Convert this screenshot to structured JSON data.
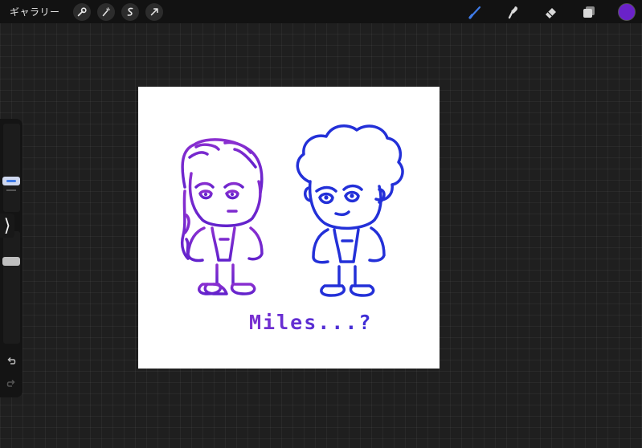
{
  "topbar": {
    "gallery_label": "ギャラリー",
    "left_tools": [
      {
        "icon": "wrench-icon"
      },
      {
        "icon": "magic-wand-icon"
      },
      {
        "icon": "selection-s-icon"
      },
      {
        "icon": "transform-arrow-icon"
      }
    ],
    "right_tools": [
      {
        "icon": "brush-icon",
        "active": true
      },
      {
        "icon": "smudge-icon"
      },
      {
        "icon": "eraser-icon"
      },
      {
        "icon": "layers-icon"
      }
    ],
    "active_color": "#6a22c9"
  },
  "sidebar": {
    "modify_glyph": "⟩"
  },
  "canvas": {
    "caption": "Miles...?",
    "left_figure_color": "#7b2fcf",
    "right_figure_color": "#2330d8"
  },
  "colors": {
    "accent_blue": "#3f7be8",
    "toolbar_bg": "#121212"
  }
}
